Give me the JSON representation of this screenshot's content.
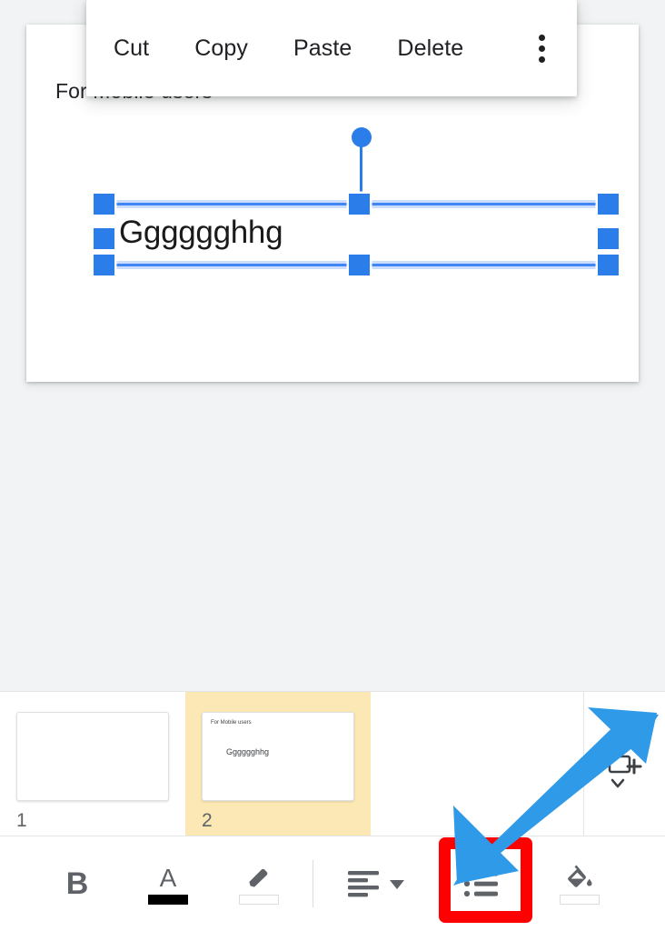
{
  "context_menu": {
    "items": [
      {
        "label": "Cut",
        "name": "cut"
      },
      {
        "label": "Copy",
        "name": "copy"
      },
      {
        "label": "Paste",
        "name": "paste"
      },
      {
        "label": "Delete",
        "name": "delete"
      }
    ],
    "overflow_icon": "more-vertical-icon"
  },
  "slide": {
    "title": "For Mobile users",
    "textbox_value": "Gggggghhg"
  },
  "filmstrip": {
    "slides": [
      {
        "number": "1",
        "title": "",
        "body": "",
        "selected": false
      },
      {
        "number": "2",
        "title": "For Mobile users",
        "body": "Gggggghhg",
        "selected": true
      }
    ],
    "add_slide_icon": "add-slide-icon"
  },
  "toolbar": {
    "items": [
      {
        "name": "bold",
        "icon": "bold-icon",
        "label": "B",
        "swatch": "none"
      },
      {
        "name": "text-color",
        "icon": "text-color-icon",
        "label": "A",
        "swatch": "black"
      },
      {
        "name": "highlight-color",
        "icon": "highlight-icon",
        "label": "",
        "swatch": "none"
      },
      {
        "name": "align",
        "icon": "align-left-icon",
        "label": "",
        "swatch": ""
      },
      {
        "name": "bulleted-list",
        "icon": "bulleted-list-icon",
        "label": "",
        "swatch": ""
      },
      {
        "name": "fill-color",
        "icon": "fill-color-icon",
        "label": "",
        "swatch": "none"
      }
    ]
  },
  "annotations": {
    "highlight_color": "#ff0000",
    "arrow_color": "#2f9ae8",
    "highlighted_tool": "bulleted-list"
  },
  "colors": {
    "selection_blue": "#2b7de9",
    "selected_slide_bg": "#fbe8b4",
    "editor_bg": "#f1f3f4"
  }
}
